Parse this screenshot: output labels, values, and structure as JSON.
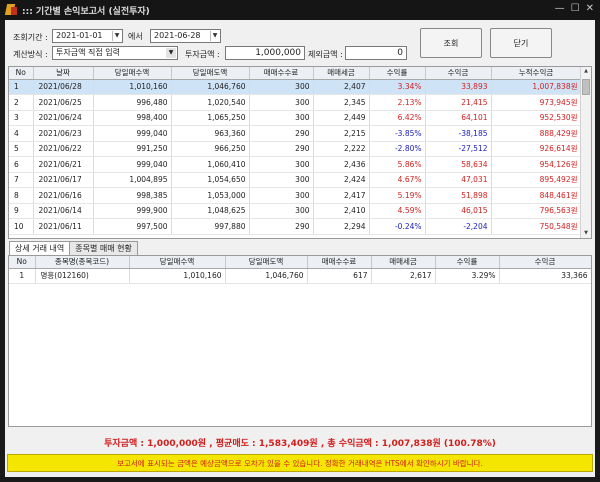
{
  "window": {
    "title": "::: 기간별 손익보고서 (실전투자)"
  },
  "form": {
    "period_label": "조회기간 :",
    "date_from": "2021-01-01",
    "between": "에서",
    "date_to": "2021-06-28",
    "calc_label": "계산방식 :",
    "calc_value": "투자금액 직접 입력",
    "invest_label": "투자금액 :",
    "invest_value": "1,000,000",
    "exclude_label": "제외금액 :",
    "exclude_value": "0"
  },
  "buttons": {
    "query": "조회",
    "close": "닫기"
  },
  "main_table": {
    "columns": [
      "No",
      "날짜",
      "당일매수액",
      "당일매도액",
      "매매수수료",
      "매매세금",
      "수익률",
      "수익금",
      "누적수익금"
    ],
    "rows": [
      [
        "1",
        "2021/06/28",
        "1,010,160",
        "1,046,760",
        "300",
        "2,407",
        "3.34%",
        "33,893",
        "1,007,838원"
      ],
      [
        "2",
        "2021/06/25",
        "996,480",
        "1,020,540",
        "300",
        "2,345",
        "2.13%",
        "21,415",
        "973,945원"
      ],
      [
        "3",
        "2021/06/24",
        "998,400",
        "1,065,250",
        "300",
        "2,449",
        "6.42%",
        "64,101",
        "952,530원"
      ],
      [
        "4",
        "2021/06/23",
        "999,040",
        "963,360",
        "290",
        "2,215",
        "-3.85%",
        "-38,185",
        "888,429원"
      ],
      [
        "5",
        "2021/06/22",
        "991,250",
        "966,250",
        "290",
        "2,222",
        "-2.80%",
        "-27,512",
        "926,614원"
      ],
      [
        "6",
        "2021/06/21",
        "999,040",
        "1,060,410",
        "300",
        "2,436",
        "5.86%",
        "58,634",
        "954,126원"
      ],
      [
        "7",
        "2021/06/17",
        "1,004,895",
        "1,054,650",
        "300",
        "2,424",
        "4.67%",
        "47,031",
        "895,492원"
      ],
      [
        "8",
        "2021/06/16",
        "998,385",
        "1,053,000",
        "300",
        "2,417",
        "5.19%",
        "51,898",
        "848,461원"
      ],
      [
        "9",
        "2021/06/14",
        "999,900",
        "1,048,625",
        "300",
        "2,410",
        "4.59%",
        "46,015",
        "796,563원"
      ],
      [
        "10",
        "2021/06/11",
        "997,500",
        "997,880",
        "290",
        "2,294",
        "-0.24%",
        "-2,204",
        "750,548원"
      ]
    ]
  },
  "tabs": [
    "상세 거래 내역",
    "종목별 매매 현황"
  ],
  "detail_table": {
    "columns": [
      "No",
      "종목명(종목코드)",
      "당일매수액",
      "당일매도액",
      "매매수수료",
      "매매세금",
      "수익률",
      "수익금"
    ],
    "rows": [
      [
        "1",
        "명흥(012160)",
        "1,010,160",
        "1,046,760",
        "617",
        "2,617",
        "3.29%",
        "33,366"
      ]
    ]
  },
  "summary": "투자금액 : 1,000,000원 , 평균매도 : 1,583,409원 , 총 수익금액 : 1,007,838원 (100.78%)",
  "notice": "보고서에 표시되는 금액은 예상금액으로 오차가 있을 수 있습니다.  정확한 거래내역은 HTS에서 확인하시기 바랍니다.",
  "colors": {
    "positive": "#d42020",
    "negative": "#2020c0",
    "notice_bg": "#f4e600",
    "selected_row": "#cfe3f7"
  }
}
